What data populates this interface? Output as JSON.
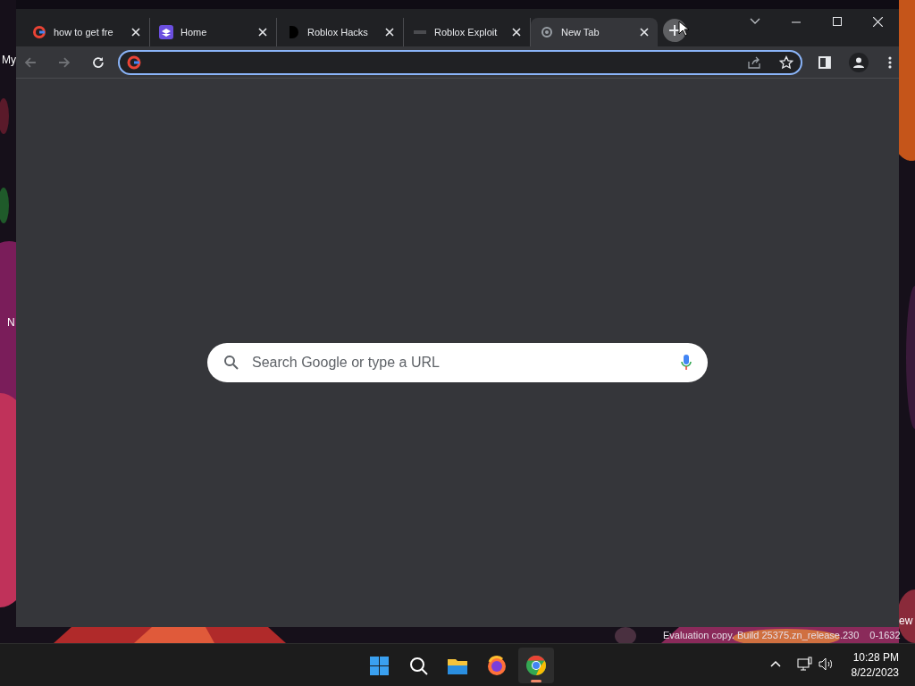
{
  "desktop": {
    "labels": [
      "My",
      "N",
      "ew"
    ],
    "watermark": "Evaluation copy. Build 25375.zn_release.230",
    "watermark_end": "0-1632"
  },
  "browser": {
    "tabs": [
      {
        "title": "how to get fre",
        "kind": "google",
        "selected": false
      },
      {
        "title": "Home",
        "kind": "layers",
        "selected": false
      },
      {
        "title": "Roblox Hacks",
        "kind": "dark",
        "selected": false
      },
      {
        "title": "Roblox Exploit",
        "kind": "faint",
        "selected": false
      },
      {
        "title": "New Tab",
        "kind": "chrome",
        "selected": true
      }
    ],
    "search": {
      "placeholder": "Search Google or type a URL"
    }
  },
  "taskbar": {
    "apps": [
      {
        "kind": "start",
        "selected": false
      },
      {
        "kind": "search",
        "selected": false
      },
      {
        "kind": "files",
        "selected": false
      },
      {
        "kind": "firefox",
        "selected": false
      },
      {
        "kind": "chrome",
        "selected": true
      }
    ],
    "time": "10:28 PM",
    "date": "8/22/2023"
  }
}
